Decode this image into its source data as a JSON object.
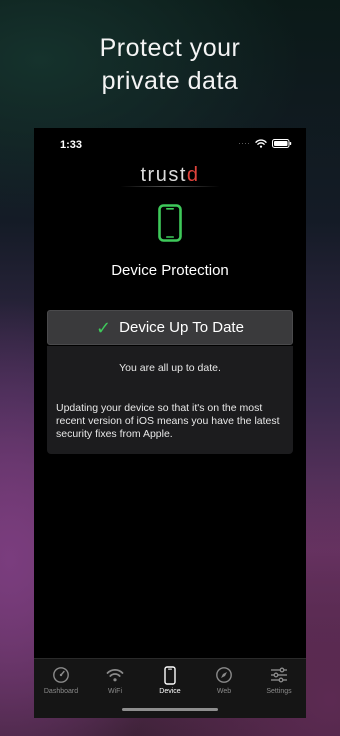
{
  "headline": {
    "line1": "Protect your",
    "line2": "private data"
  },
  "status_bar": {
    "time": "1:33",
    "dots": "····"
  },
  "app": {
    "logo_main": "trust",
    "logo_accent": "d"
  },
  "hero": {
    "title": "Device Protection",
    "icon": "smartphone-icon",
    "icon_color": "#3ec95a"
  },
  "status_button": {
    "check": "✓",
    "label": "Device Up To Date",
    "check_color": "#3ec95a"
  },
  "info": {
    "summary": "You are all up to date.",
    "detail": "Updating your device so that it's on the most recent version of iOS means you have the latest security fixes from Apple."
  },
  "tabs": [
    {
      "label": "Dashboard",
      "icon": "gauge-icon",
      "active": false
    },
    {
      "label": "WiFi",
      "icon": "wifi-icon",
      "active": false
    },
    {
      "label": "Device",
      "icon": "smartphone-icon",
      "active": true
    },
    {
      "label": "Web",
      "icon": "compass-icon",
      "active": false
    },
    {
      "label": "Settings",
      "icon": "sliders-icon",
      "active": false
    }
  ],
  "colors": {
    "accent_red": "#e0433c",
    "accent_green": "#3ec95a"
  }
}
